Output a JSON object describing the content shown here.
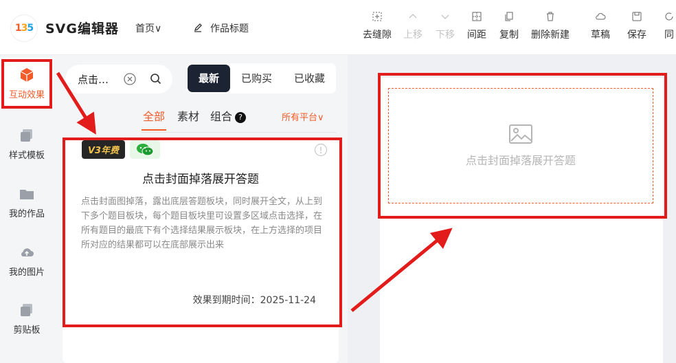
{
  "header": {
    "logo_text": "135",
    "brand": "SVG编辑器",
    "home": "首页∨",
    "title_placeholder": "作品标题",
    "tools": [
      {
        "label": "去缝隙",
        "icon": "gap-icon",
        "disabled": false
      },
      {
        "label": "上移",
        "icon": "chevron-up-icon",
        "disabled": true
      },
      {
        "label": "下移",
        "icon": "chevron-down-icon",
        "disabled": true
      },
      {
        "label": "间距",
        "icon": "spacing-icon",
        "disabled": false
      },
      {
        "label": "复制",
        "icon": "copy-icon",
        "disabled": false
      },
      {
        "label": "删除新建",
        "icon": "delete-new-icon",
        "disabled": false
      },
      {
        "label": "草稿",
        "icon": "cloud-icon",
        "disabled": false
      },
      {
        "label": "保存",
        "icon": "save-icon",
        "disabled": false
      },
      {
        "label": "同",
        "icon": "sync-icon",
        "disabled": false
      }
    ]
  },
  "sidebar": {
    "items": [
      {
        "label": "互动效果",
        "icon": "cube-icon",
        "active": true
      },
      {
        "label": "样式模板",
        "icon": "template-icon",
        "active": false
      },
      {
        "label": "我的作品",
        "icon": "folder-icon",
        "active": false
      },
      {
        "label": "我的图片",
        "icon": "cloud-upload-icon",
        "active": false
      },
      {
        "label": "剪贴板",
        "icon": "clipboard-icon",
        "active": false
      }
    ]
  },
  "panel": {
    "search_value": "点击…",
    "segments": [
      "最新",
      "已购买",
      "已收藏"
    ],
    "active_segment": 0,
    "tabs": [
      "全部",
      "素材",
      "组合"
    ],
    "tab_help": "?",
    "platform": "所有平台∨",
    "card": {
      "badge": "V3年费",
      "title": "点击封面掉落展开答题",
      "description": "点击封面图掉落，露出底层答题板块，同时展开全文，从上到下多个题目板块，每个题目板块里可设置多区域点击选择，在所有题目的最底下有个选择结果展示板块，在上方选择的项目所对应的结果都可以在底部展示出来",
      "expire": "效果到期时间：2025-11-24"
    }
  },
  "canvas": {
    "placeholder_text": "点击封面掉落展开答题"
  },
  "colors": {
    "accent": "#f25c2a",
    "annotation": "#e21b1b",
    "dark_segment": "#1c2434"
  }
}
